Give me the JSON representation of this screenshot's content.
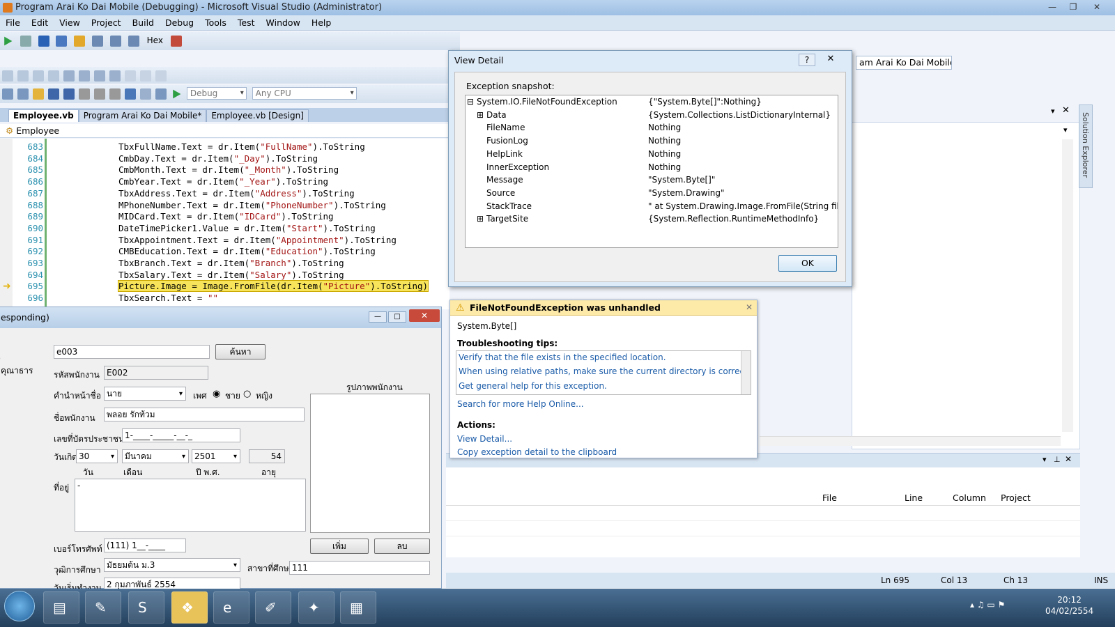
{
  "window": {
    "title": "Program Arai Ko Dai Mobile (Debugging) - Microsoft Visual Studio (Administrator)"
  },
  "menu": [
    "File",
    "Edit",
    "View",
    "Project",
    "Build",
    "Debug",
    "Tools",
    "Test",
    "Window",
    "Help"
  ],
  "toolbar": {
    "hex_label": "Hex",
    "config": "Debug",
    "platform": "Any CPU",
    "project_combo": "am Arai Ko Dai Mobile"
  },
  "tabs": [
    {
      "label": "Employee.vb"
    },
    {
      "label": "Program Arai Ko Dai Mobile*"
    },
    {
      "label": "Employee.vb [Design]"
    }
  ],
  "navbar": {
    "class_name": "Employee"
  },
  "editor": {
    "lines": [
      {
        "n": "683",
        "pre": "TbxFullName.Text = dr.Item(",
        "str": "\"FullName\"",
        "post": ").ToString"
      },
      {
        "n": "684",
        "pre": "CmbDay.Text = dr.Item(",
        "str": "\"_Day\"",
        "post": ").ToString"
      },
      {
        "n": "685",
        "pre": "CmbMonth.Text = dr.Item(",
        "str": "\"_Month\"",
        "post": ").ToString"
      },
      {
        "n": "686",
        "pre": "CmbYear.Text = dr.Item(",
        "str": "\"_Year\"",
        "post": ").ToString"
      },
      {
        "n": "687",
        "pre": "TbxAddress.Text = dr.Item(",
        "str": "\"Address\"",
        "post": ").ToString"
      },
      {
        "n": "688",
        "pre": "MPhoneNumber.Text = dr.Item(",
        "str": "\"PhoneNumber\"",
        "post": ").ToString"
      },
      {
        "n": "689",
        "pre": "MIDCard.Text = dr.Item(",
        "str": "\"IDCard\"",
        "post": ").ToString"
      },
      {
        "n": "690",
        "pre": "DateTimePicker1.Value = dr.Item(",
        "str": "\"Start\"",
        "post": ").ToString"
      },
      {
        "n": "691",
        "pre": "TbxAppointment.Text = dr.Item(",
        "str": "\"Appointment\"",
        "post": ").ToString"
      },
      {
        "n": "692",
        "pre": "CMBEducation.Text = dr.Item(",
        "str": "\"Education\"",
        "post": ").ToString"
      },
      {
        "n": "693",
        "pre": "TbxBranch.Text = dr.Item(",
        "str": "\"Branch\"",
        "post": ").ToString"
      },
      {
        "n": "694",
        "pre": "TbxSalary.Text = dr.Item(",
        "str": "\"Salary\"",
        "post": ").ToString"
      },
      {
        "n": "695",
        "pre": "Picture.Image = Image.FromFile(dr.Item(",
        "str": "\"Picture\"",
        "post": ").ToString)"
      },
      {
        "n": "696",
        "pre": "TbxSearch.Text = ",
        "str": "\"\"",
        "post": ""
      }
    ]
  },
  "view_detail": {
    "title": "View Detail",
    "help": "?",
    "close": "✕",
    "snapshot_label": "Exception snapshot:",
    "rows": [
      {
        "toggle": "⊟",
        "key": "System.IO.FileNotFoundException",
        "value": "{\"System.Byte[]\":Nothing}"
      },
      {
        "toggle": "⊞",
        "key": "Data",
        "value": "{System.Collections.ListDictionaryInternal}"
      },
      {
        "toggle": "",
        "key": "FileName",
        "value": "Nothing"
      },
      {
        "toggle": "",
        "key": "FusionLog",
        "value": "Nothing"
      },
      {
        "toggle": "",
        "key": "HelpLink",
        "value": "Nothing"
      },
      {
        "toggle": "",
        "key": "InnerException",
        "value": "Nothing"
      },
      {
        "toggle": "",
        "key": "Message",
        "value": "\"System.Byte[]\""
      },
      {
        "toggle": "",
        "key": "Source",
        "value": "\"System.Drawing\""
      },
      {
        "toggle": "",
        "key": "StackTrace",
        "value": "\"   at System.Drawing.Image.FromFile(String filename"
      },
      {
        "toggle": "⊞",
        "key": "TargetSite",
        "value": "{System.Reflection.RuntimeMethodInfo}"
      }
    ],
    "ok": "OK"
  },
  "exception": {
    "title": "FileNotFoundException was unhandled",
    "message": "System.Byte[]",
    "tips_label": "Troubleshooting tips:",
    "tips": [
      "Verify that the file exists in the specified location.",
      "When using relative paths, make sure the current directory is correct.",
      "Get general help for this exception."
    ],
    "search_help": "Search for more Help Online...",
    "actions_label": "Actions:",
    "view_detail": "View Detail...",
    "copy_detail": "Copy exception detail to the clipboard"
  },
  "error_list": {
    "columns": [
      "File",
      "Line",
      "Column",
      "Project"
    ]
  },
  "status": {
    "ln": "Ln 695",
    "col": "Col 13",
    "ch": "Ch 13",
    "ins": "INS"
  },
  "form": {
    "title": "esponding)",
    "side1": "ุ",
    "side2": "คุณาธาร",
    "search_value": "e003",
    "search_btn": "ค้นหา",
    "emp_id_label": "รหัสพนักงาน",
    "emp_id": "E002",
    "prefix_label": "คำนำหน้าชื่อ",
    "prefix": "นาย",
    "gender_label": "เพศ",
    "male": "ชาย",
    "female": "หญิง",
    "photo_label": "รูปภาพพนักงาน",
    "name_label": "ชื่อพนักงาน",
    "name": "พลอย รักท้วม",
    "idcard_label": "เลขที่บัตรประชาชน",
    "idcard": "1-____-_____-__-_",
    "birth_label": "วันเกิด",
    "day": "30",
    "month": "มีนาคม",
    "year": "2501",
    "age": "54",
    "day_label": "วัน",
    "month_label": "เดือน",
    "year_label": "ปี พ.ศ.",
    "age_label": "อายุ",
    "address_label": "ที่อยู่",
    "address": "-",
    "phone_label": "เบอร์โทรศัพท์",
    "phone": "(111) 1__-____",
    "add_btn": "เพิ่ม",
    "del_btn": "ลบ",
    "edu_label": "วุฒิการศึกษา",
    "education": "มัธยมต้น ม.3",
    "branch_label": "สาขาที่ศึกษา",
    "branch": "111",
    "start_label": "วันเริ่มทำงาน",
    "start_date": "2  กุมภาพันธ์   2554",
    "close": "✕"
  },
  "taskbar": {
    "time": "20:12",
    "date": "04/02/2554"
  }
}
